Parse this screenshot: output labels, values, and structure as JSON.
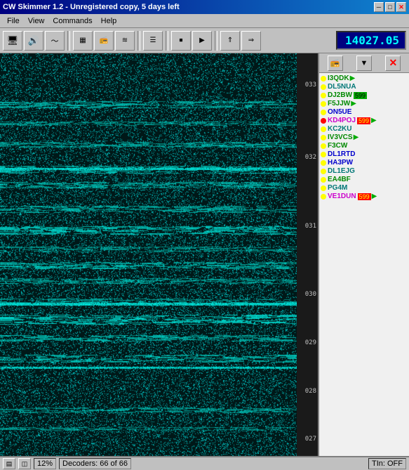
{
  "titleBar": {
    "title": "CW Skimmer 1.2 - Unregistered copy, 5 days left",
    "minBtn": "─",
    "maxBtn": "□",
    "closeBtn": "✕"
  },
  "menuBar": {
    "items": [
      "File",
      "View",
      "Commands",
      "Help"
    ]
  },
  "toolbar": {
    "buttons": [
      "🖥",
      "🔊",
      "🎙",
      "📊",
      "📻",
      "📶",
      "📋",
      "⏹",
      "⏯",
      "⏩",
      "➡"
    ],
    "frequency": "14027.05"
  },
  "callsignPanel": {
    "headerBtns": [
      "📻",
      "▼",
      "✕"
    ],
    "callsigns": [
      {
        "dot": "yellow",
        "name": "I3QDK",
        "color": "green",
        "badge": "",
        "arrow": "▶"
      },
      {
        "dot": "yellow",
        "name": "DL5NUA",
        "color": "cyan",
        "badge": "",
        "arrow": ""
      },
      {
        "dot": "yellow",
        "name": "DJ2BW",
        "color": "green",
        "badge": "599",
        "arrow": ""
      },
      {
        "dot": "yellow",
        "name": "F5JJW",
        "color": "green",
        "badge": "",
        "arrow": "▶"
      },
      {
        "dot": "yellow",
        "name": "ON5UE",
        "color": "blue",
        "badge": "",
        "arrow": ""
      },
      {
        "dot": "red",
        "name": "KD4POJ",
        "color": "magenta",
        "badge": "599",
        "arrow": "▶"
      },
      {
        "dot": "yellow",
        "name": "KC2KU",
        "color": "cyan",
        "badge": "",
        "arrow": ""
      },
      {
        "dot": "yellow",
        "name": "IV3VCS",
        "color": "green",
        "badge": "",
        "arrow": "▶"
      },
      {
        "dot": "yellow",
        "name": "F3CW",
        "color": "green",
        "badge": "",
        "arrow": ""
      },
      {
        "dot": "yellow",
        "name": "DL1RTD",
        "color": "blue",
        "badge": "",
        "arrow": ""
      },
      {
        "dot": "yellow",
        "name": "HA3PW",
        "color": "blue",
        "badge": "",
        "arrow": ""
      },
      {
        "dot": "yellow",
        "name": "DL1EJG",
        "color": "cyan",
        "badge": "",
        "arrow": ""
      },
      {
        "dot": "yellow",
        "name": "EA4BF",
        "color": "green",
        "badge": "",
        "arrow": ""
      },
      {
        "dot": "yellow",
        "name": "PG4M",
        "color": "cyan",
        "badge": "",
        "arrow": ""
      },
      {
        "dot": "yellow",
        "name": "VE1DUN",
        "color": "magenta",
        "badge": "599",
        "arrow": "▶"
      }
    ]
  },
  "freqMarkers": [
    {
      "label": "033",
      "top_pct": 9
    },
    {
      "label": "032",
      "top_pct": 27
    },
    {
      "label": "031",
      "top_pct": 44
    },
    {
      "label": "030",
      "top_pct": 61
    },
    {
      "label": "029",
      "top_pct": 72
    },
    {
      "label": "028",
      "top_pct": 85
    },
    {
      "label": "027",
      "top_pct": 97
    }
  ],
  "statusBar": {
    "zoom": "12%",
    "decoders": "Decoders: 66 of 66",
    "tln": "TIn: OFF"
  }
}
